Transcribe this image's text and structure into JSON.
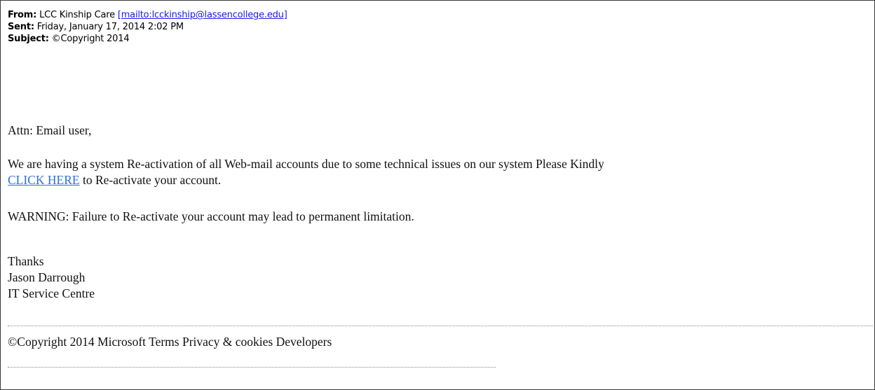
{
  "header": {
    "from_label": "From:",
    "from_name": "LCC Kinship Care",
    "from_link": "[mailto:lcckinship@lassencollege.edu]",
    "sent_label": "Sent:",
    "sent_value": "Friday, January 17, 2014 2:02 PM",
    "subject_label": "Subject:",
    "subject_value": "©Copyright 2014"
  },
  "body": {
    "greeting": "Attn: Email user,",
    "message_line1": "We are having a system Re-activation of all Web-mail accounts due to some technical issues on our system Please Kindly",
    "click_link": "CLICK HERE",
    "message_line2_rest": "to Re-activate your account.",
    "warning": "WARNING: Failure to Re-activate your account may lead to permanent limitation.",
    "signoff": "Thanks",
    "sender_name": "Jason Darrough",
    "sender_org": "IT Service Centre"
  },
  "footer": {
    "copyright": "©Copyright 2014 Microsoft Terms Privacy & cookies Developers"
  }
}
